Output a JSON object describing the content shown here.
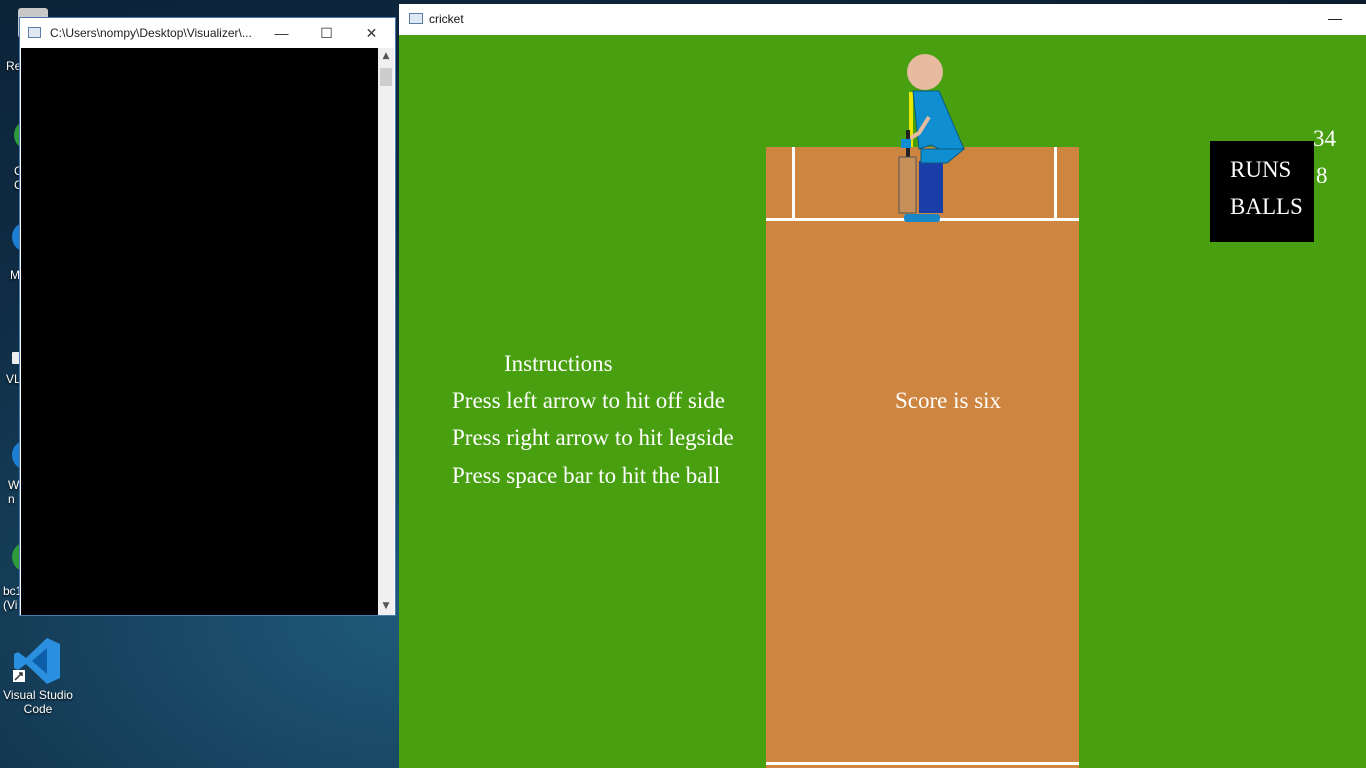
{
  "desktop": {
    "icons": [
      {
        "name": "Recycle Bin",
        "label": "Re"
      },
      {
        "name": "icon-2",
        "label": "C\nC"
      },
      {
        "name": "icon-3",
        "label": "M"
      },
      {
        "name": "VLC",
        "label": "VL"
      },
      {
        "name": "icon-5",
        "label": "W\nn"
      },
      {
        "name": "bc1",
        "label": "bc1\n(Vi"
      },
      {
        "name": "Visual Studio Code",
        "label": "Visual Studio\nCode"
      }
    ]
  },
  "console_window": {
    "title": "C:\\Users\\nompy\\Desktop\\Visualizer\\...",
    "minimize_glyph": "—",
    "maximize_glyph": "☐",
    "close_glyph": "✕",
    "scroll_up_glyph": "▲",
    "scroll_down_glyph": "▼"
  },
  "cricket_window": {
    "title": "cricket",
    "minimize_glyph": "—",
    "instructions": {
      "heading": "Instructions",
      "lines": [
        "Press left arrow to hit off side",
        "Press right arrow to hit legside",
        "Press space bar to hit the ball"
      ]
    },
    "status_message": "Score is six",
    "scoreboard": {
      "runs_label": "RUNS",
      "runs_value": "34",
      "balls_label": "BALLS",
      "balls_value": "8"
    },
    "colors": {
      "grass": "#48a010",
      "pitch": "#cd853f",
      "creases": "#ffffff",
      "batsman_shirt": "#0f8fd2",
      "batsman_trousers": "#1a3ea8",
      "batsman_head": "#e7bba0",
      "bat": "#c7905a",
      "stumps": "#e8e800"
    }
  }
}
